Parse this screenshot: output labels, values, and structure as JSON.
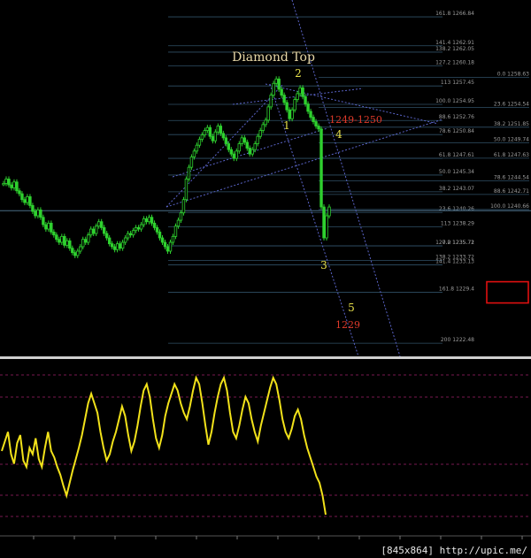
{
  "chart_data": {
    "type": "candlestick",
    "title": "Diamond Top",
    "waves": [
      "1",
      "2",
      "3",
      "4",
      "5"
    ],
    "zone_labels": [
      "1249-1250",
      "1229"
    ],
    "fib_left": [
      {
        "ratio": "161.8",
        "price": "1266.84"
      },
      {
        "ratio": "141.4",
        "price": "1262.91"
      },
      {
        "ratio": "138.2",
        "price": "1262.05"
      },
      {
        "ratio": "127.2",
        "price": "1260.18"
      },
      {
        "ratio": "113",
        "price": "1257.45"
      },
      {
        "ratio": "100.0",
        "price": "1254.95"
      },
      {
        "ratio": "88.6",
        "price": "1252.76"
      },
      {
        "ratio": "78.6",
        "price": "1250.84"
      },
      {
        "ratio": "61.8",
        "price": "1247.61"
      },
      {
        "ratio": "50.0",
        "price": "1245.34"
      },
      {
        "ratio": "38.2",
        "price": "1243.07"
      },
      {
        "ratio": "23.6",
        "price": "1240.26"
      },
      {
        "ratio": "113",
        "price": "1238.29"
      },
      {
        "ratio": "0.0",
        "price": "1235.72"
      },
      {
        "ratio": "127.2",
        "price": "1235.71"
      },
      {
        "ratio": "138.2",
        "price": "1233.72"
      },
      {
        "ratio": "141.4",
        "price": "1233.13"
      },
      {
        "ratio": "161.8",
        "price": "1229.4"
      },
      {
        "ratio": "200",
        "price": "1222.48"
      }
    ],
    "fib_right": [
      {
        "ratio": "0.0",
        "price": "1258.63"
      },
      {
        "ratio": "23.6",
        "price": "1254.54"
      },
      {
        "ratio": "38.2",
        "price": "1251.85"
      },
      {
        "ratio": "50.0",
        "price": "1249.74"
      },
      {
        "ratio": "61.8",
        "price": "1247.63"
      },
      {
        "ratio": "78.6",
        "price": "1244.54"
      },
      {
        "ratio": "88.6",
        "price": "1242.71"
      },
      {
        "ratio": "100.0",
        "price": "1240.66"
      }
    ],
    "candles": [
      1244.2,
      1244.8,
      1244.0,
      1243.6,
      1244.4,
      1243.2,
      1242.8,
      1242.0,
      1241.6,
      1242.4,
      1241.2,
      1240.4,
      1239.8,
      1240.6,
      1239.6,
      1238.6,
      1238.0,
      1238.8,
      1237.6,
      1237.2,
      1236.6,
      1236.2,
      1237.0,
      1235.8,
      1236.4,
      1235.4,
      1234.8,
      1234.4,
      1235.0,
      1235.6,
      1236.6,
      1236.2,
      1237.2,
      1238.0,
      1237.4,
      1238.4,
      1239.0,
      1238.2,
      1237.4,
      1236.8,
      1236.0,
      1235.6,
      1235.2,
      1236.0,
      1235.4,
      1236.2,
      1236.8,
      1237.4,
      1237.2,
      1237.8,
      1238.2,
      1238.0,
      1238.6,
      1239.4,
      1239.0,
      1239.6,
      1238.8,
      1238.2,
      1237.6,
      1236.8,
      1236.2,
      1235.6,
      1235.0,
      1236.2,
      1237.0,
      1238.4,
      1239.2,
      1240.2,
      1242.0,
      1244.8,
      1246.4,
      1247.8,
      1248.6,
      1249.4,
      1250.2,
      1250.8,
      1251.4,
      1251.8,
      1250.6,
      1250.0,
      1251.2,
      1252.0,
      1251.0,
      1250.4,
      1249.6,
      1248.8,
      1248.2,
      1247.6,
      1248.6,
      1249.6,
      1250.4,
      1249.8,
      1249.0,
      1248.2,
      1248.8,
      1249.6,
      1250.6,
      1251.4,
      1252.2,
      1252.8,
      1254.6,
      1256.2,
      1257.8,
      1258.4,
      1257.0,
      1256.2,
      1255.2,
      1254.2,
      1253.0,
      1254.2,
      1255.6,
      1256.4,
      1257.2,
      1256.0,
      1255.0,
      1254.0,
      1253.2,
      1252.6,
      1252.0,
      1251.6,
      1241.0,
      1236.8,
      1239.8,
      1241.0
    ],
    "oscillator": [
      50,
      56,
      62,
      48,
      42,
      55,
      60,
      44,
      40,
      52,
      48,
      58,
      45,
      40,
      52,
      62,
      50,
      46,
      40,
      35,
      28,
      22,
      30,
      38,
      45,
      52,
      60,
      70,
      80,
      86,
      80,
      74,
      62,
      52,
      44,
      48,
      56,
      62,
      70,
      78,
      72,
      60,
      50,
      56,
      66,
      78,
      88,
      92,
      84,
      70,
      58,
      52,
      60,
      72,
      80,
      86,
      92,
      88,
      80,
      74,
      70,
      78,
      88,
      96,
      92,
      80,
      66,
      54,
      62,
      74,
      84,
      92,
      96,
      88,
      74,
      62,
      58,
      66,
      76,
      84,
      80,
      70,
      62,
      56,
      66,
      74,
      82,
      90,
      96,
      92,
      82,
      70,
      62,
      58,
      64,
      72,
      76,
      70,
      60,
      52,
      46,
      40,
      34,
      30,
      22,
      10
    ]
  }
}
